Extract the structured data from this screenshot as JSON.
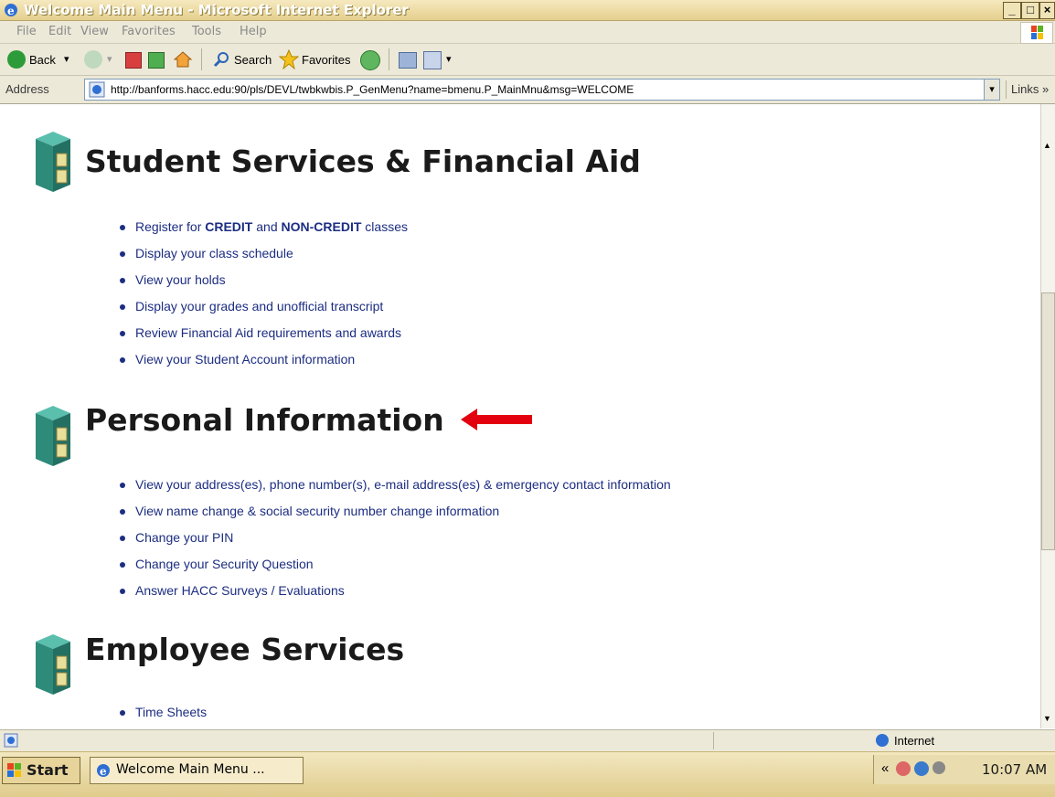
{
  "window": {
    "title": "Welcome Main Menu - Microsoft Internet Explorer",
    "minimize_label": "_",
    "maximize_label": "□",
    "close_label": "×"
  },
  "menubar": {
    "items": [
      "File",
      "Edit",
      "View",
      "Favorites",
      "Tools",
      "Help"
    ]
  },
  "toolbar": {
    "back_label": "Back",
    "search_label": "Search",
    "favorites_label": "Favorites",
    "dropdown_glyph": "▾"
  },
  "address": {
    "label": "Address",
    "url": "http://banforms.hacc.edu:90/pls/DEVL/twbkwbis.P_GenMenu?name=bmenu.P_MainMnu&msg=WELCOME",
    "links_label": "Links »",
    "dropdown_glyph": "▾"
  },
  "sections": [
    {
      "title": "Student Services & Financial Aid",
      "links": [
        {
          "pre": "Register for ",
          "b1": "CREDIT",
          "mid": " and ",
          "b2": "NON-CREDIT",
          "post": " classes"
        },
        {
          "text": "Display your class schedule"
        },
        {
          "text": "View your holds"
        },
        {
          "text": "Display your grades and unofficial transcript"
        },
        {
          "text": "Review Financial Aid requirements and awards"
        },
        {
          "text": "View your Student Account information"
        }
      ]
    },
    {
      "title": "Personal Information",
      "links": [
        {
          "text": "View your address(es), phone number(s), e-mail address(es) & emergency contact information"
        },
        {
          "text": "View name change & social security number change information"
        },
        {
          "text": "Change your PIN"
        },
        {
          "text": "Change your Security Question"
        },
        {
          "text": "Answer HACC Surveys / Evaluations"
        }
      ]
    },
    {
      "title": "Employee Services",
      "links": [
        {
          "text": "Time Sheets"
        }
      ]
    }
  ],
  "status": {
    "zone": "Internet"
  },
  "taskbar": {
    "start_label": "Start",
    "task_label": "Welcome Main Menu ...",
    "tray_chevron": "«",
    "clock": "10:07 AM"
  },
  "colors": {
    "link": "#1c2d82",
    "arrow": "#e3000f",
    "cabinet": "#2e8b7a"
  }
}
